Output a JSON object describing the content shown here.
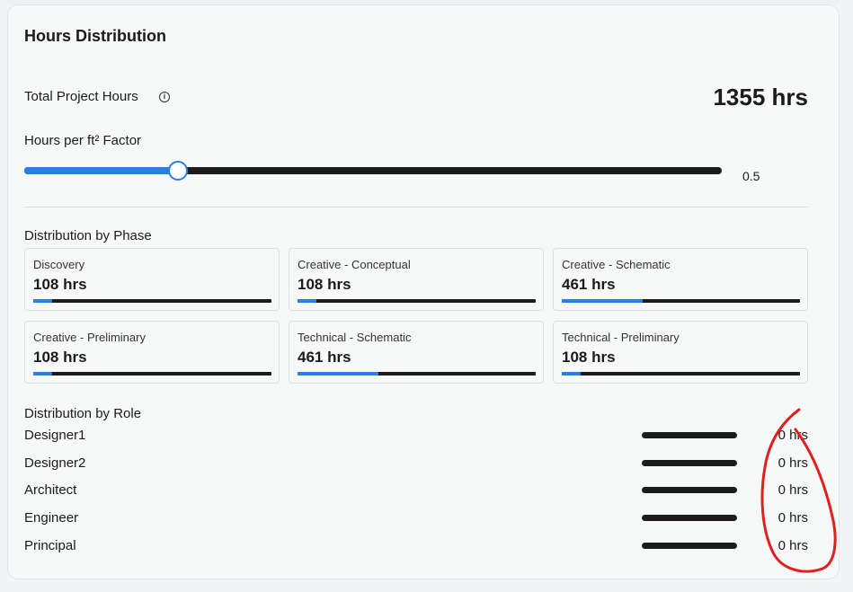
{
  "card": {
    "title": "Hours Distribution"
  },
  "total": {
    "label": "Total Project Hours",
    "info_icon": "info-icon",
    "value": "1355 hrs"
  },
  "factor": {
    "label": "Hours per ft² Factor",
    "value": "0.5",
    "fraction": 0.22
  },
  "phases": {
    "label": "Distribution by Phase",
    "items": [
      {
        "name": "Discovery",
        "hours": "108 hrs",
        "fraction": 0.08
      },
      {
        "name": "Creative - Conceptual",
        "hours": "108 hrs",
        "fraction": 0.08
      },
      {
        "name": "Creative - Schematic",
        "hours": "461 hrs",
        "fraction": 0.34
      },
      {
        "name": "Creative - Preliminary",
        "hours": "108 hrs",
        "fraction": 0.08
      },
      {
        "name": "Technical - Schematic",
        "hours": "461 hrs",
        "fraction": 0.34
      },
      {
        "name": "Technical - Preliminary",
        "hours": "108 hrs",
        "fraction": 0.08
      }
    ]
  },
  "roles": {
    "label": "Distribution by Role",
    "items": [
      {
        "name": "Designer1",
        "hours": "0 hrs",
        "fraction": 0
      },
      {
        "name": "Designer2",
        "hours": "0 hrs",
        "fraction": 0
      },
      {
        "name": "Architect",
        "hours": "0 hrs",
        "fraction": 0
      },
      {
        "name": "Engineer",
        "hours": "0 hrs",
        "fraction": 0
      },
      {
        "name": "Principal",
        "hours": "0 hrs",
        "fraction": 0
      }
    ]
  },
  "colors": {
    "accent": "#2b7de9",
    "track": "#1d1b19",
    "annotation": "#e02020"
  }
}
